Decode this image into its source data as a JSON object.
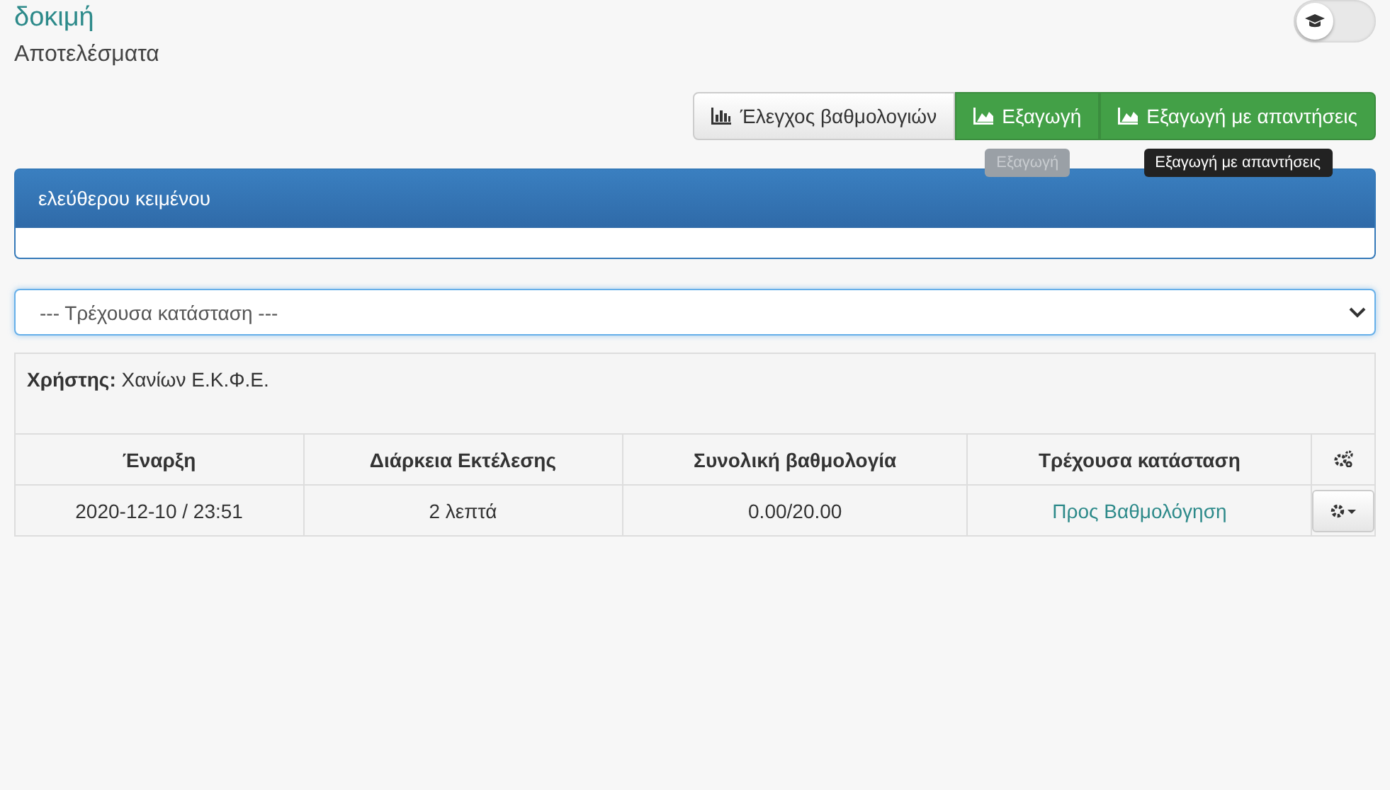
{
  "header": {
    "title": "δοκιμή",
    "subtitle": "Αποτελέσματα",
    "toggle": {
      "on": false
    }
  },
  "toolbar": {
    "buttons": [
      {
        "label": "Έλεγχος βαθμολογιών",
        "kind": "default"
      },
      {
        "label": "Εξαγωγή",
        "kind": "success",
        "tooltip": {
          "text": "Εξαγωγή",
          "faded": true
        }
      },
      {
        "label": "Εξαγωγή με απαντήσεις",
        "kind": "success",
        "tooltip": {
          "text": "Εξαγωγή με απαντήσεις",
          "faded": false
        }
      }
    ]
  },
  "panel": {
    "title": "ελεύθερου κειμένου"
  },
  "filter": {
    "value": "--- Τρέχουσα κατάσταση ---"
  },
  "results": {
    "user_label": "Χρήστης:",
    "user": "Χανίων Ε.Κ.Φ.Ε.",
    "columns": [
      "Έναρξη",
      "Διάρκεια Εκτέλεσης",
      "Συνολική βαθμολογία",
      "Τρέχουσα κατάσταση"
    ],
    "rows": [
      {
        "cells": [
          "2020-12-10 / 23:51",
          "2 λεπτά",
          "0.00/20.00",
          "Προς Βαθμολόγηση"
        ]
      }
    ]
  }
}
